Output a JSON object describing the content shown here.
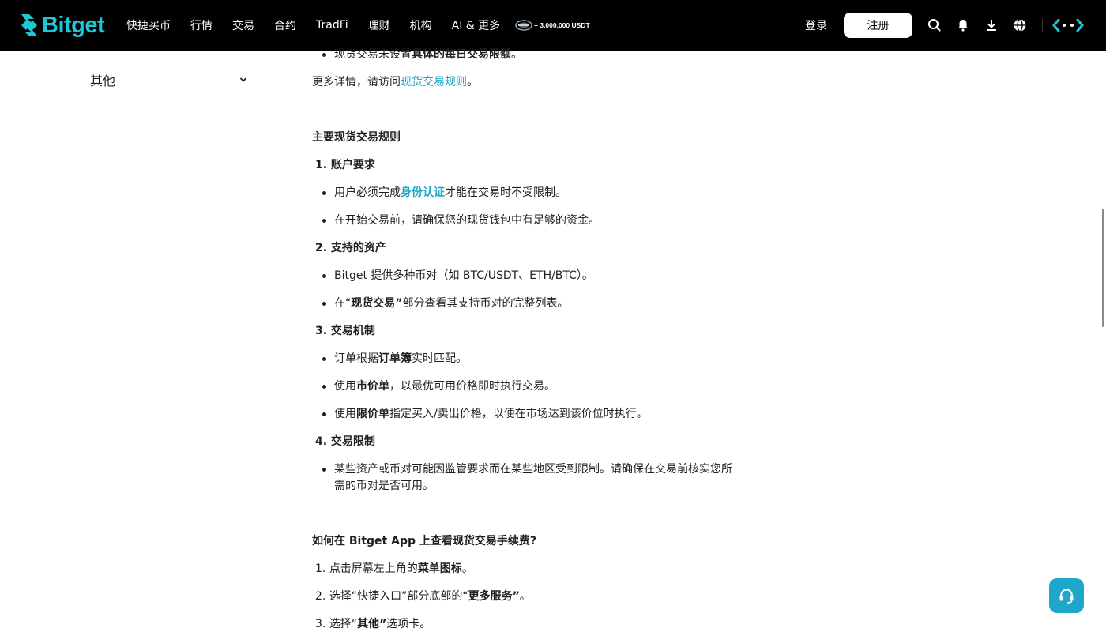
{
  "header": {
    "logo_text": "Bitget",
    "nav": [
      "快捷买币",
      "行情",
      "交易",
      "合约",
      "TradFi",
      "理财",
      "机构",
      "AI & 更多"
    ],
    "promo_text": "+ 3,000,000 USDT",
    "login_label": "登录",
    "register_label": "注册",
    "icons": [
      "search-icon",
      "bell-icon",
      "download-icon",
      "globe-icon",
      "brand-arrows-icon"
    ]
  },
  "sidebar": {
    "items": [
      {
        "label": "其他"
      }
    ]
  },
  "content": {
    "top_bullet": {
      "pre": "现货交易未设置",
      "bold": "具体的每日交易限额",
      "post": "。"
    },
    "details": {
      "pre": "更多详情，请访问",
      "link": "现货交易规则",
      "post": "。"
    },
    "rules_title": "主要现货交易规则",
    "s1": {
      "title": "1. 账户要求",
      "b1": {
        "pre": "用户必须完成",
        "link": "身份认证",
        "post": "才能在交易时不受限制。"
      },
      "b2": "在开始交易前，请确保您的现货钱包中有足够的资金。"
    },
    "s2": {
      "title": "2. 支持的资产",
      "b1": "Bitget 提供多种币对（如 BTC/USDT、ETH/BTC）。",
      "b2": {
        "pre": "在“",
        "bold": "现货交易”",
        "post": "部分查看其支持币对的完整列表。"
      }
    },
    "s3": {
      "title": "3. 交易机制",
      "b1": {
        "pre": "订单根据",
        "bold": "订单簿",
        "post": "实时匹配。"
      },
      "b2": {
        "pre": "使用",
        "bold": "市价单",
        "post": "，以最优可用价格即时执行交易。"
      },
      "b3": {
        "pre": "使用",
        "bold": "限价单",
        "post": "指定买入/卖出价格，以便在市场达到该价位时执行。"
      }
    },
    "s4": {
      "title": "4. 交易限制",
      "b1_line1": "某些资产或币对可能因监管要求而在某些地区受到限制。请确保在交易前核实您所",
      "b1_line2": "需的币对是否可用。"
    },
    "app_title": "如何在 Bitget App 上查看现货交易手续费?",
    "steps": [
      {
        "num": "1.",
        "pre": "点击屏幕左上角的",
        "bold": "菜单图标",
        "post": "。"
      },
      {
        "num": "2.",
        "pre": "选择“快捷入口”部分底部的“",
        "bold": "更多服务”",
        "post": "。"
      },
      {
        "num": "3.",
        "pre": "选择“",
        "bold": "其他”",
        "post": "选项卡。"
      }
    ]
  },
  "colors": {
    "accent": "#1fa7c9",
    "logo": "#1fc7d4",
    "header_bg": "#000000"
  }
}
